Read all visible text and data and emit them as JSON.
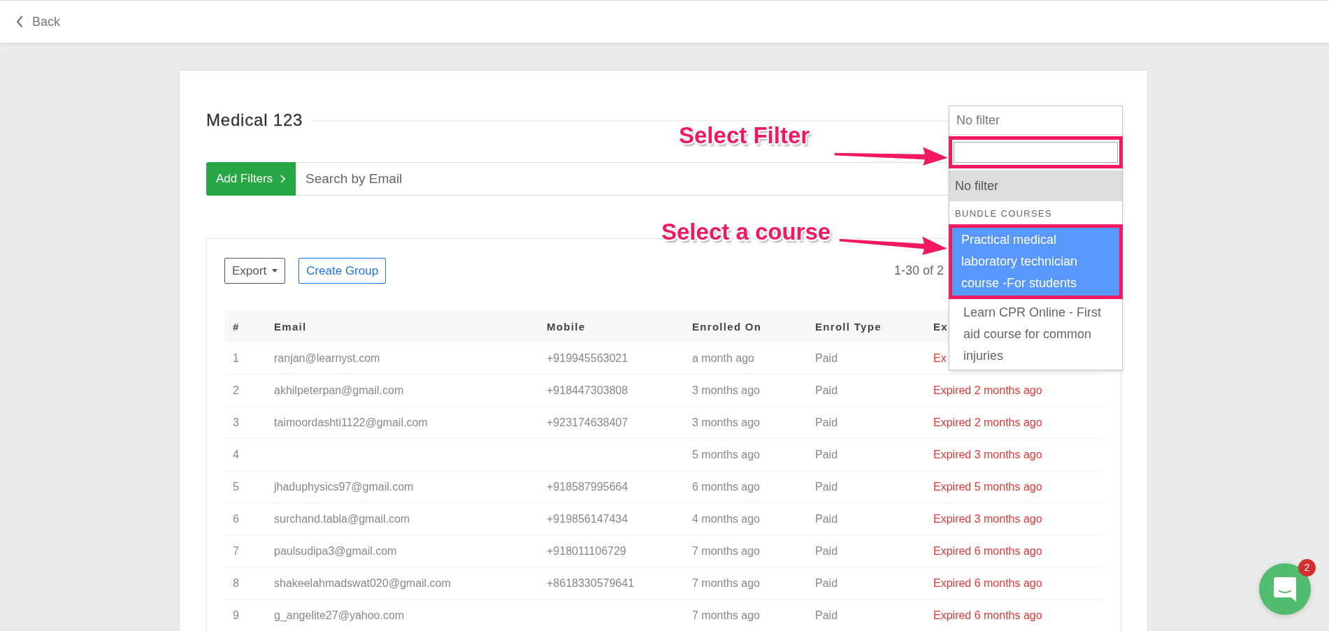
{
  "header": {
    "back_label": "Back"
  },
  "page": {
    "title": "Medical 123"
  },
  "filter_bar": {
    "button": "Add Filters",
    "search_placeholder": "Search by Email"
  },
  "toolbar": {
    "export": "Export",
    "create_group": "Create Group",
    "pagination": "1-30 of 2"
  },
  "table": {
    "columns": [
      "#",
      "Email",
      "Mobile",
      "Enrolled On",
      "Enroll Type",
      "Ex"
    ],
    "rows": [
      {
        "index": "1",
        "email": "ranjan@learnyst.com",
        "mobile": "+919945563021",
        "enrolled_on": "a month ago",
        "enroll_type": "Paid",
        "expiry": "Ex",
        "expired": true
      },
      {
        "index": "2",
        "email": "akhilpeterpan@gmail.com",
        "mobile": "+918447303808",
        "enrolled_on": "3 months ago",
        "enroll_type": "Paid",
        "expiry": "Expired 2 months ago",
        "expired": true
      },
      {
        "index": "3",
        "email": "taimoordashti1122@gmail.com",
        "mobile": "+923174638407",
        "enrolled_on": "3 months ago",
        "enroll_type": "Paid",
        "expiry": "Expired 2 months ago",
        "expired": true
      },
      {
        "index": "4",
        "enrolled_on": "5 months ago",
        "enroll_type": "Paid",
        "expiry": "Expired 3 months ago",
        "expired": true
      },
      {
        "index": "5",
        "email": "jhaduphysics97@gmail.com",
        "mobile": "+918587995664",
        "enrolled_on": "6 months ago",
        "enroll_type": "Paid",
        "expiry": "Expired 5 months ago",
        "expired": true
      },
      {
        "index": "6",
        "email": "surchand.tabla@gmail.com",
        "mobile": "+919856147434",
        "enrolled_on": "4 months ago",
        "enroll_type": "Paid",
        "expiry": "Expired 3 months ago",
        "expired": true
      },
      {
        "index": "7",
        "email": "paulsudipa3@gmail.com",
        "mobile": "+918011106729",
        "enrolled_on": "7 months ago",
        "enroll_type": "Paid",
        "expiry": "Expired 6 months ago",
        "expired": true
      },
      {
        "index": "8",
        "email": "shakeelahmadswat020@gmail.com",
        "mobile": "+8618330579641",
        "enrolled_on": "7 months ago",
        "enroll_type": "Paid",
        "expiry": "Expired 6 months ago",
        "expired": true
      },
      {
        "index": "9",
        "email": "g_angelite27@yahoo.com",
        "enrolled_on": "7 months ago",
        "enroll_type": "Paid",
        "expiry": "Expired 6 months ago",
        "expired": true
      }
    ]
  },
  "dropdown": {
    "value": "No filter",
    "search": {
      "annotated": true
    },
    "options": [
      {
        "kind": "option",
        "label": "No filter",
        "selected": true,
        "highlighted": false,
        "annotated": false
      },
      {
        "kind": "group",
        "label": "BUNDLE COURSES"
      },
      {
        "kind": "option",
        "label": "Practical medical laboratory technician course -For students",
        "selected": false,
        "highlighted": true,
        "annotated": true
      },
      {
        "kind": "option",
        "label": "Learn CPR Online - First aid course for common injuries",
        "selected": false,
        "highlighted": false,
        "annotated": false
      }
    ]
  },
  "annotations": [
    {
      "text": "Select Filter"
    },
    {
      "text": "Select a course"
    }
  ],
  "chat": {
    "badge": "2"
  }
}
